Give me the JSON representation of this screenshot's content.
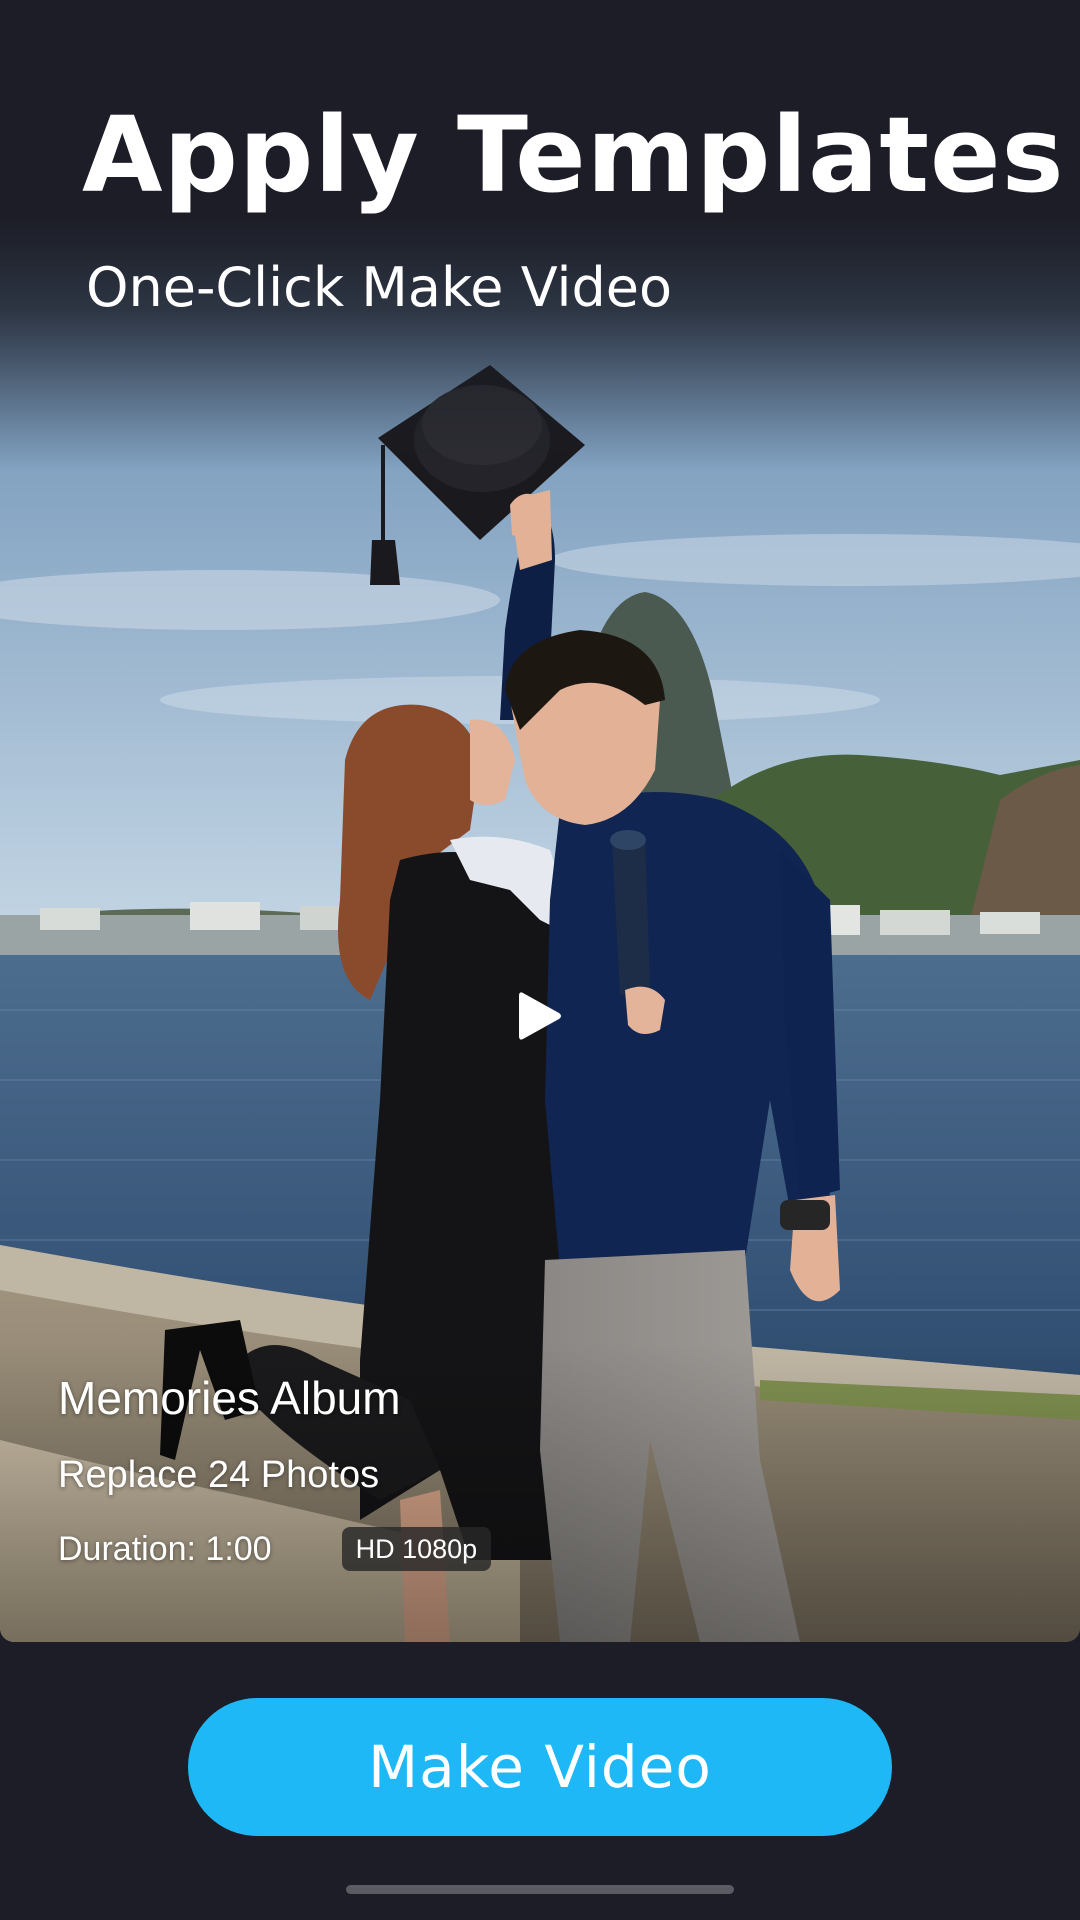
{
  "header": {
    "title": "Apply Templates",
    "subtitle": "One-Click Make Video"
  },
  "preview": {
    "image_subject": "graduation-couple-photo",
    "play_icon": "play-icon"
  },
  "template": {
    "name": "Memories Album",
    "photos": "Replace 24 Photos",
    "duration": "Duration: 1:00",
    "quality_badge": "HD 1080p"
  },
  "cta": {
    "label": "Make Video"
  },
  "colors": {
    "background": "#1c1d26",
    "accent": "#1db8f5",
    "text": "#ffffff"
  }
}
